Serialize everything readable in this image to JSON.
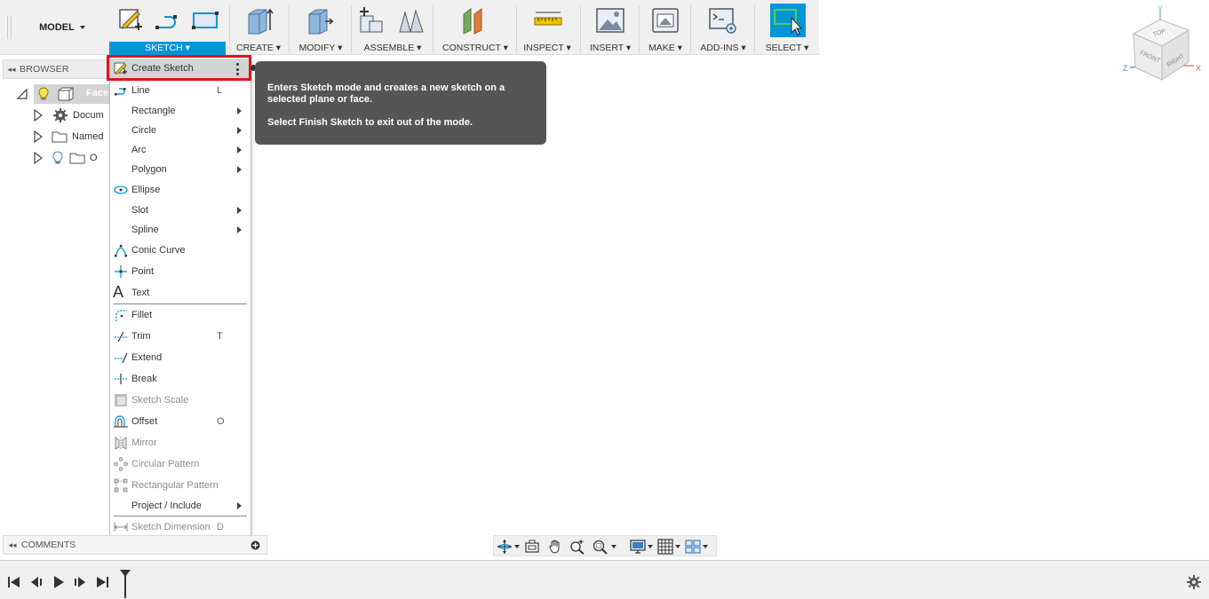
{
  "toolbar": {
    "model_label": "MODEL",
    "groups": {
      "sketch": "SKETCH",
      "create": "CREATE",
      "modify": "MODIFY",
      "assemble": "ASSEMBLE",
      "construct": "CONSTRUCT",
      "inspect": "INSPECT",
      "insert": "INSERT",
      "make": "MAKE",
      "addins": "ADD-INS",
      "select": "SELECT"
    }
  },
  "browser": {
    "title": "BROWSER",
    "items": [
      {
        "label": "Face",
        "icon": "component-icon"
      },
      {
        "label": "Docum",
        "icon": "gear-icon"
      },
      {
        "label": "Named",
        "icon": "folder-icon"
      },
      {
        "label": "O",
        "icon": "folder-icon"
      }
    ]
  },
  "sketch_menu": {
    "items": [
      {
        "label": "Create Sketch"
      },
      {
        "label": "Line",
        "shortcut": "L"
      },
      {
        "label": "Rectangle"
      },
      {
        "label": "Circle"
      },
      {
        "label": "Arc"
      },
      {
        "label": "Polygon"
      },
      {
        "label": "Ellipse"
      },
      {
        "label": "Slot"
      },
      {
        "label": "Spline"
      },
      {
        "label": "Conic Curve"
      },
      {
        "label": "Point"
      },
      {
        "label": "Text"
      },
      {
        "label": "Fillet"
      },
      {
        "label": "Trim",
        "shortcut": "T"
      },
      {
        "label": "Extend"
      },
      {
        "label": "Break"
      },
      {
        "label": "Sketch Scale"
      },
      {
        "label": "Offset",
        "shortcut": "O"
      },
      {
        "label": "Mirror"
      },
      {
        "label": "Circular Pattern"
      },
      {
        "label": "Rectangular Pattern"
      },
      {
        "label": "Project / Include"
      },
      {
        "label": "Sketch Dimension",
        "shortcut": "D"
      }
    ]
  },
  "tooltip": {
    "line1": "Enters Sketch mode and creates a new sketch on a selected plane or face.",
    "line2": "Select Finish Sketch to exit out of the mode."
  },
  "comments": {
    "title": "COMMENTS"
  },
  "viewcube": {
    "top": "TOP",
    "front": "FRONT",
    "right": "RIGHT",
    "axis_x": "X",
    "axis_y": "Y",
    "axis_z": "Z"
  },
  "colors": {
    "accent": "#0696d7",
    "highlight": "#e0141e",
    "tooltip_bg": "#555555"
  }
}
